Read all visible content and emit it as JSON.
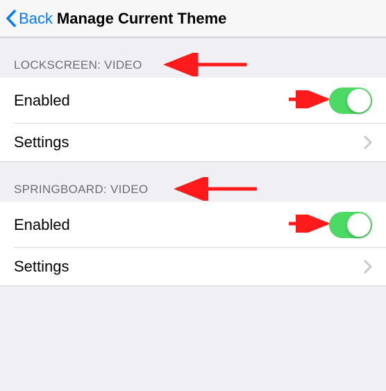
{
  "nav": {
    "back_label": "Back",
    "title": "Manage Current Theme"
  },
  "sections": [
    {
      "header": "LOCKSCREEN: VIDEO",
      "rows": [
        {
          "label": "Enabled",
          "kind": "toggle",
          "on": true
        },
        {
          "label": "Settings",
          "kind": "disclosure"
        }
      ]
    },
    {
      "header": "SPRINGBOARD: VIDEO",
      "rows": [
        {
          "label": "Enabled",
          "kind": "toggle",
          "on": true
        },
        {
          "label": "Settings",
          "kind": "disclosure"
        }
      ]
    }
  ],
  "colors": {
    "tint": "#007aff",
    "toggle_on": "#4cd964",
    "annotation": "#ff1b1b"
  }
}
